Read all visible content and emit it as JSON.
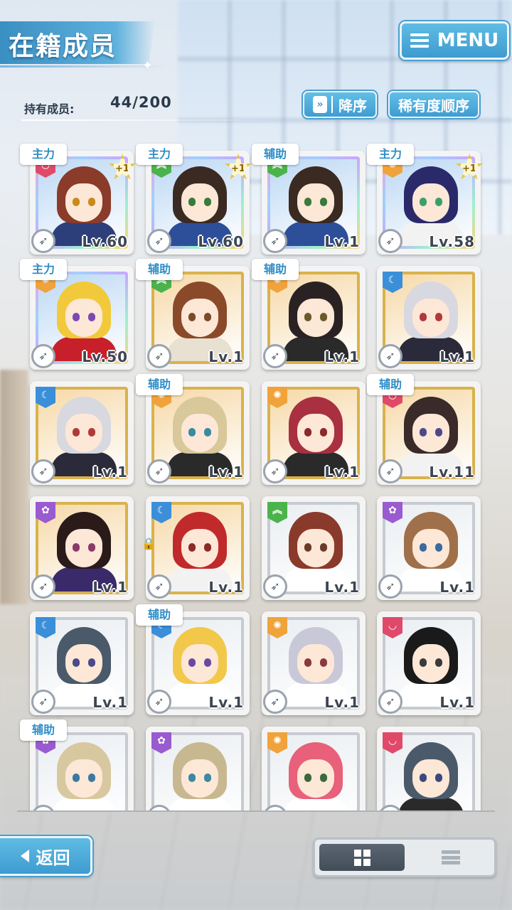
{
  "header": {
    "title": "在籍成员",
    "menu_label": "MENU",
    "owned_label": "持有成员:",
    "owned_count": "44/200",
    "sort_order_label": "降序",
    "sort_rarity_label": "稀有度顺序"
  },
  "colors": {
    "accent_blue": "#3e9bd0",
    "attr_red": "#e04a6a",
    "attr_green": "#4bb34b",
    "attr_orange": "#f0a33a",
    "attr_blue": "#3a8fd8",
    "attr_purple": "#9a5ad0"
  },
  "members": [
    {
      "role": "主力",
      "attr": "red",
      "plus": "+1",
      "level": "Lv.60",
      "frame": "rainbow",
      "hair": "#8a3b2a",
      "eye": "#c98a1a",
      "outfit": "#2d3f7a"
    },
    {
      "role": "主力",
      "attr": "green",
      "plus": "+1",
      "level": "Lv.60",
      "frame": "rainbow",
      "hair": "#3a2a22",
      "eye": "#3a7a3a",
      "outfit": "#2d4f9a"
    },
    {
      "role": "辅助",
      "attr": "green",
      "plus": "",
      "level": "Lv.1",
      "frame": "rainbow",
      "hair": "#3a2a22",
      "eye": "#3a7a3a",
      "outfit": "#2d4f9a"
    },
    {
      "role": "主力",
      "attr": "orange",
      "plus": "+1",
      "level": "Lv.58",
      "frame": "rainbow",
      "hair": "#2a2a6a",
      "eye": "#3aa06a",
      "outfit": "#f2f2f2"
    },
    {
      "role": "主力",
      "attr": "orange",
      "plus": "",
      "level": "Lv.50",
      "frame": "rainbow",
      "hair": "#f2c93a",
      "eye": "#7a4ab0",
      "outfit": "#c8202a"
    },
    {
      "role": "辅助",
      "attr": "green",
      "plus": "",
      "level": "Lv.1",
      "frame": "gold",
      "hair": "#8a4a2a",
      "eye": "#7a4a2a",
      "outfit": "#e8e0d0"
    },
    {
      "role": "辅助",
      "attr": "orange",
      "plus": "",
      "level": "Lv.1",
      "frame": "gold",
      "hair": "#2a2222",
      "eye": "#6a5a2a",
      "outfit": "#2a2a2a"
    },
    {
      "role": "",
      "attr": "blue",
      "plus": "",
      "level": "Lv.1",
      "frame": "gold",
      "hair": "#d8d8e0",
      "eye": "#b03a3a",
      "outfit": "#2a2a3a"
    },
    {
      "role": "",
      "attr": "blue",
      "plus": "",
      "level": "Lv.1",
      "frame": "gold",
      "hair": "#d8d8e0",
      "eye": "#b03a3a",
      "outfit": "#2a2a3a"
    },
    {
      "role": "辅助",
      "attr": "orange",
      "plus": "",
      "level": "Lv.1",
      "frame": "gold",
      "hair": "#d8c89a",
      "eye": "#3a8aa0",
      "outfit": "#2a2a2a"
    },
    {
      "role": "",
      "attr": "orange",
      "plus": "",
      "level": "Lv.1",
      "frame": "gold",
      "hair": "#a83040",
      "eye": "#8a2a2a",
      "outfit": "#2a2a2a"
    },
    {
      "role": "辅助",
      "attr": "red",
      "plus": "",
      "level": "Lv.11",
      "frame": "gold",
      "hair": "#3a2a2a",
      "eye": "#4a4a8a",
      "outfit": "#f2f2f2"
    },
    {
      "role": "",
      "attr": "purple",
      "plus": "",
      "level": "Lv.1",
      "frame": "gold",
      "hair": "#2a1a1a",
      "eye": "#8a3a6a",
      "outfit": "#3a2a6a"
    },
    {
      "role": "",
      "attr": "blue",
      "plus": "",
      "level": "Lv.1",
      "frame": "gold",
      "hair": "#c02a2a",
      "eye": "#8a2a2a",
      "outfit": "#f2f2f2",
      "locked": true
    },
    {
      "role": "",
      "attr": "green",
      "plus": "",
      "level": "Lv.1",
      "frame": "silver",
      "hair": "#8a3a2a",
      "eye": "#6a3a2a",
      "outfit": "#ffffff"
    },
    {
      "role": "",
      "attr": "purple",
      "plus": "",
      "level": "Lv.1",
      "frame": "silver",
      "hair": "#a0704a",
      "eye": "#3a6aa0",
      "outfit": "#ffffff"
    },
    {
      "role": "",
      "attr": "blue",
      "plus": "",
      "level": "Lv.1",
      "frame": "silver",
      "hair": "#4a5a6a",
      "eye": "#4a4a8a",
      "outfit": "#ffffff"
    },
    {
      "role": "辅助",
      "attr": "blue",
      "plus": "",
      "level": "Lv.1",
      "frame": "silver",
      "hair": "#f2c84a",
      "eye": "#6a4aa0",
      "outfit": "#ffffff"
    },
    {
      "role": "",
      "attr": "orange",
      "plus": "",
      "level": "Lv.1",
      "frame": "silver",
      "hair": "#c8c8d8",
      "eye": "#8a3a3a",
      "outfit": "#ffffff"
    },
    {
      "role": "",
      "attr": "red",
      "plus": "",
      "level": "Lv.1",
      "frame": "silver",
      "hair": "#1a1a1a",
      "eye": "#3a3a3a",
      "outfit": "#ffffff"
    },
    {
      "role": "辅助",
      "attr": "purple",
      "plus": "",
      "level": "",
      "frame": "silver",
      "hair": "#d8c8a0",
      "eye": "#3a7aa0",
      "outfit": "#ffffff"
    },
    {
      "role": "",
      "attr": "purple",
      "plus": "",
      "level": "",
      "frame": "silver",
      "hair": "#c8b890",
      "eye": "#3a8aa0",
      "outfit": "#ffffff"
    },
    {
      "role": "",
      "attr": "orange",
      "plus": "",
      "level": "",
      "frame": "silver",
      "hair": "#e8607a",
      "eye": "#3a6a3a",
      "outfit": "#ffffff"
    },
    {
      "role": "",
      "attr": "red",
      "plus": "",
      "level": "",
      "frame": "silver",
      "hair": "#4a5a6a",
      "eye": "#3a4a7a",
      "outfit": "#2a2a2a"
    }
  ],
  "footer": {
    "back_label": "返回",
    "view_mode": "grid"
  }
}
